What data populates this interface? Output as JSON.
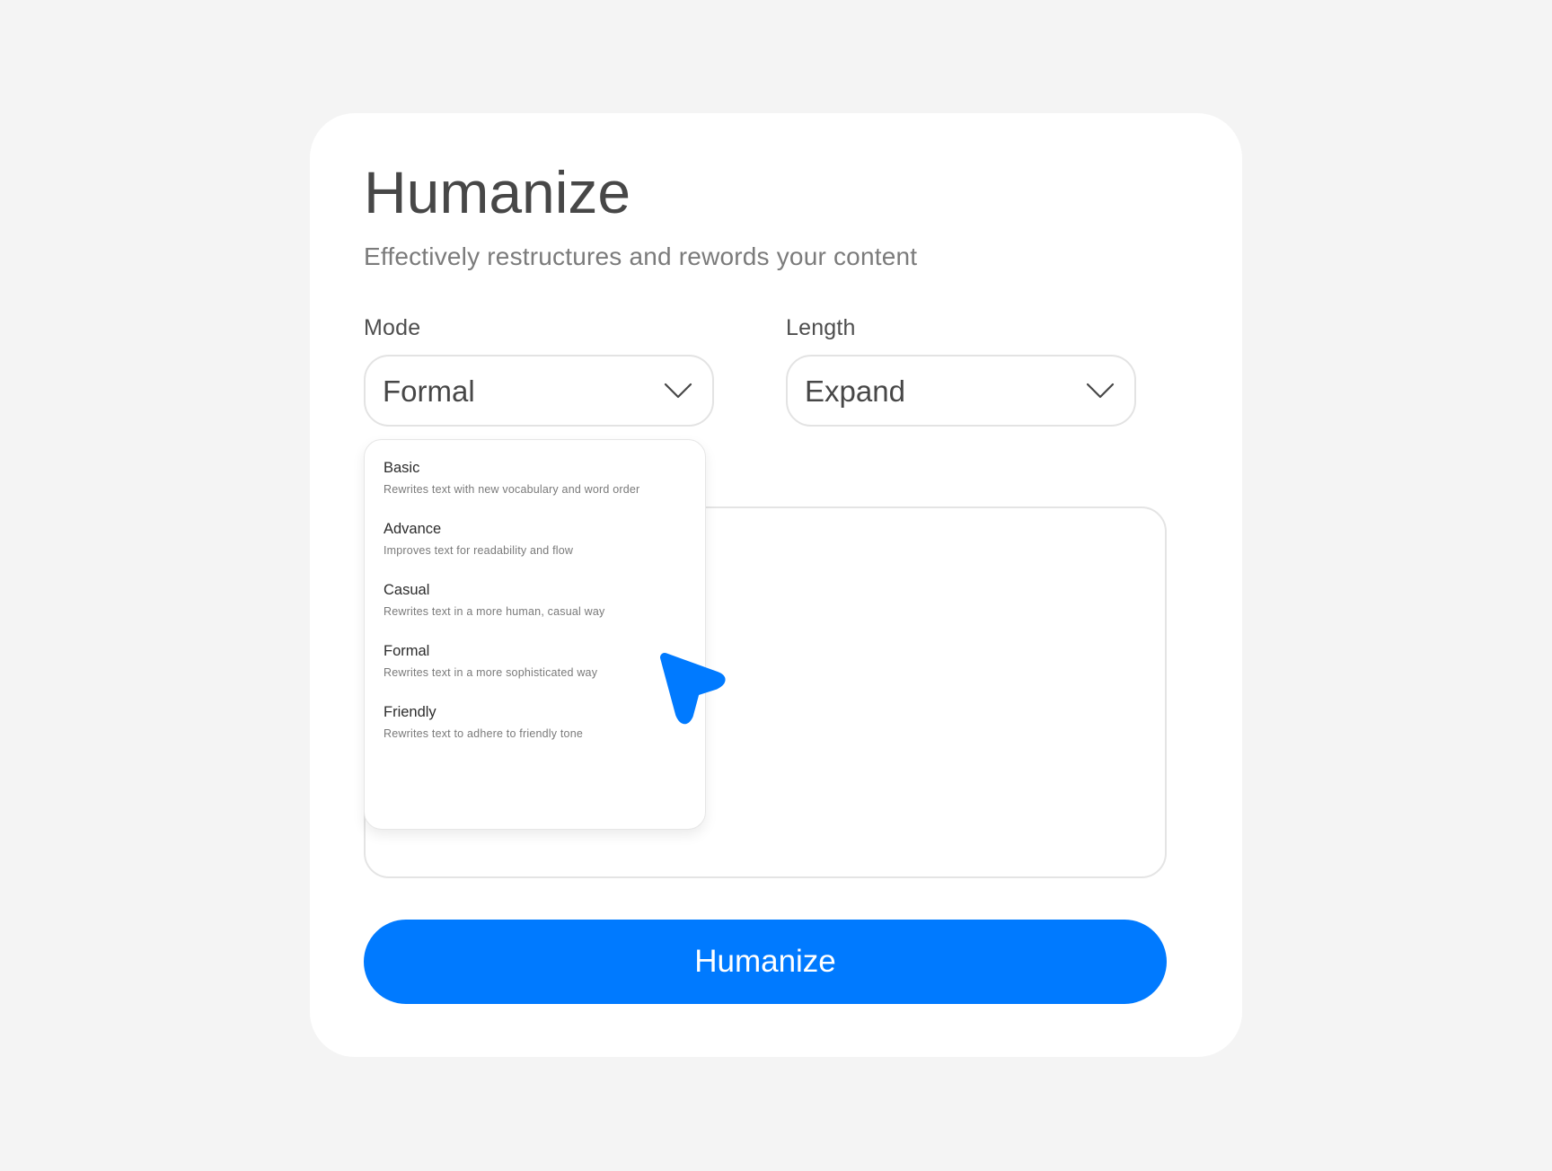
{
  "header": {
    "title": "Humanize",
    "subtitle": "Effectively restructures and rewords your content"
  },
  "mode": {
    "label": "Mode",
    "selected": "Formal",
    "options": [
      {
        "title": "Basic",
        "description": "Rewrites text with new vocabulary and word order"
      },
      {
        "title": "Advance",
        "description": "Improves text for readability and flow"
      },
      {
        "title": "Casual",
        "description": "Rewrites text in a more human, casual way"
      },
      {
        "title": "Formal",
        "description": "Rewrites text in a more sophisticated way"
      },
      {
        "title": "Friendly",
        "description": "Rewrites text to adhere to friendly tone"
      }
    ]
  },
  "length": {
    "label": "Length",
    "selected": "Expand"
  },
  "action": {
    "label": "Humanize"
  },
  "icons": {
    "select_chevron": "chevron-down-icon",
    "pointer": "mouse-pointer-icon"
  },
  "colors": {
    "accent": "#007aff",
    "page_background": "#f4f4f4",
    "card_background": "#ffffff",
    "title_text": "#474747"
  }
}
